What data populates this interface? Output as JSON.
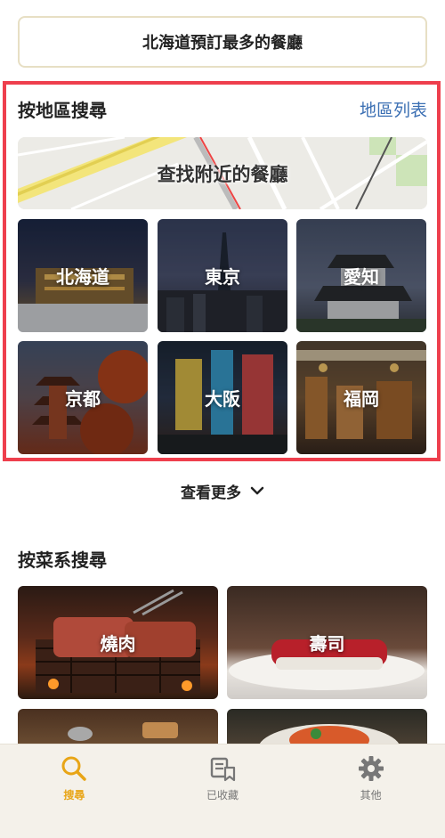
{
  "top_button": {
    "label": "北海道預訂最多的餐廳"
  },
  "region_section": {
    "title": "按地區搜尋",
    "map_link": "地區列表",
    "nearby_label": "查找附近的餐廳",
    "regions": [
      {
        "label": "北海道"
      },
      {
        "label": "東京"
      },
      {
        "label": "愛知"
      },
      {
        "label": "京都"
      },
      {
        "label": "大阪"
      },
      {
        "label": "福岡"
      }
    ]
  },
  "more": {
    "label": "查看更多"
  },
  "cuisine_section": {
    "title": "按菜系搜尋",
    "items": [
      {
        "label": "燒肉"
      },
      {
        "label": "壽司"
      },
      {
        "label": ""
      },
      {
        "label": ""
      }
    ]
  },
  "tabbar": {
    "items": [
      {
        "label": "搜尋",
        "icon": "search-icon"
      },
      {
        "label": "已收藏",
        "icon": "bookmark-list-icon"
      },
      {
        "label": "其他",
        "icon": "gear-icon"
      }
    ]
  },
  "colors": {
    "accent": "#e8a516",
    "link": "#3b6fb3",
    "highlight_border": "#ee3f4d"
  }
}
